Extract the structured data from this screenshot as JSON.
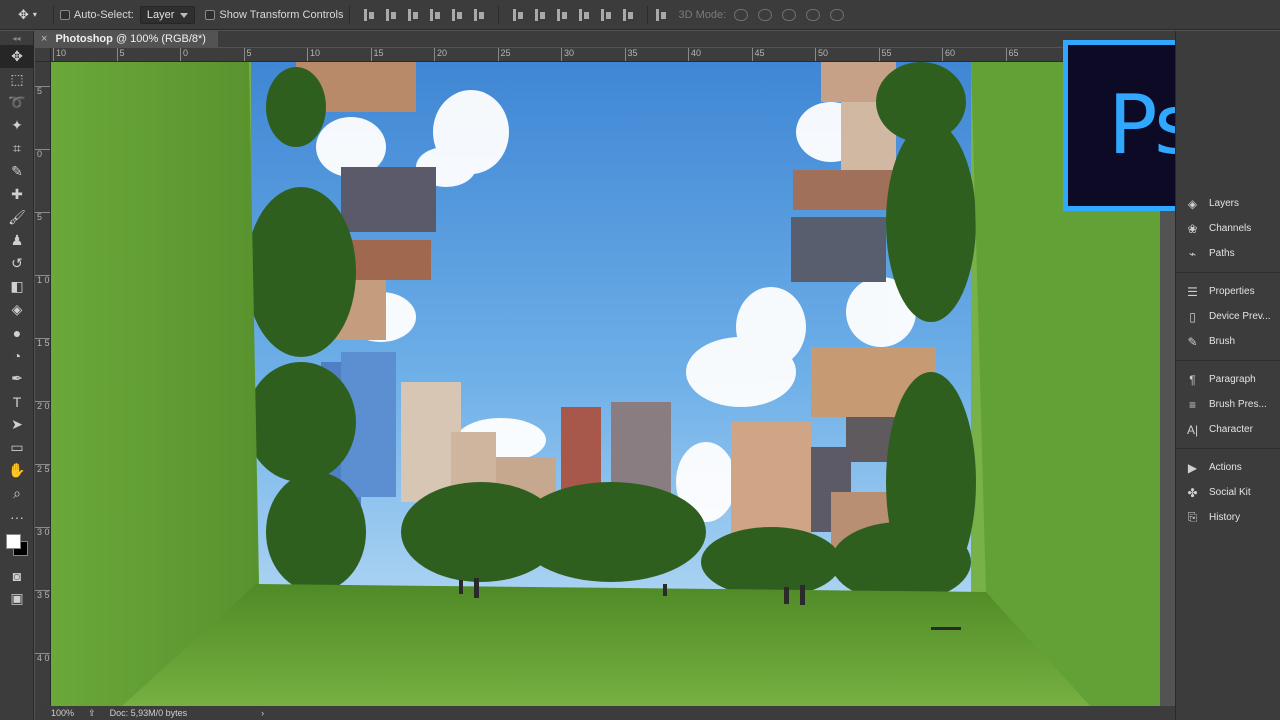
{
  "options_bar": {
    "auto_select_label": "Auto-Select:",
    "auto_select_value": "Layer",
    "show_transform_label": "Show Transform Controls",
    "three_d_mode_label": "3D Mode:"
  },
  "document": {
    "tab_title": "Photoshop",
    "tab_info": "@ 100% (RGB/8*)"
  },
  "ruler": {
    "top_labels": [
      "10",
      "5",
      "0",
      "5",
      "10",
      "15",
      "20",
      "25",
      "30",
      "35",
      "40",
      "45",
      "50",
      "55",
      "60",
      "65"
    ],
    "left_labels": [
      "5",
      "0",
      "5",
      "1 0",
      "1 5",
      "2 0",
      "2 5",
      "3 0",
      "3 5",
      "4 0"
    ]
  },
  "status": {
    "zoom": "100%",
    "doc_info": "Doc: 5,93M/0 bytes"
  },
  "panels": {
    "group1": [
      {
        "icon": "layers-icon",
        "label": "Layers"
      },
      {
        "icon": "channels-icon",
        "label": "Channels"
      },
      {
        "icon": "paths-icon",
        "label": "Paths"
      }
    ],
    "group2": [
      {
        "icon": "properties-icon",
        "label": "Properties"
      },
      {
        "icon": "device-preview-icon",
        "label": "Device Prev..."
      },
      {
        "icon": "brush-icon",
        "label": "Brush"
      }
    ],
    "group3": [
      {
        "icon": "paragraph-icon",
        "label": "Paragraph"
      },
      {
        "icon": "brush-presets-icon",
        "label": "Brush Pres..."
      },
      {
        "icon": "character-icon",
        "label": "Character"
      }
    ],
    "group4": [
      {
        "icon": "actions-icon",
        "label": "Actions"
      },
      {
        "icon": "social-kit-icon",
        "label": "Social Kit"
      },
      {
        "icon": "history-icon",
        "label": "History"
      }
    ]
  },
  "logo": {
    "text": "Ps",
    "color": "#31a8ff",
    "bg": "#0d0a26"
  },
  "colors": {
    "foreground": "#ffffff",
    "background": "#000000"
  }
}
